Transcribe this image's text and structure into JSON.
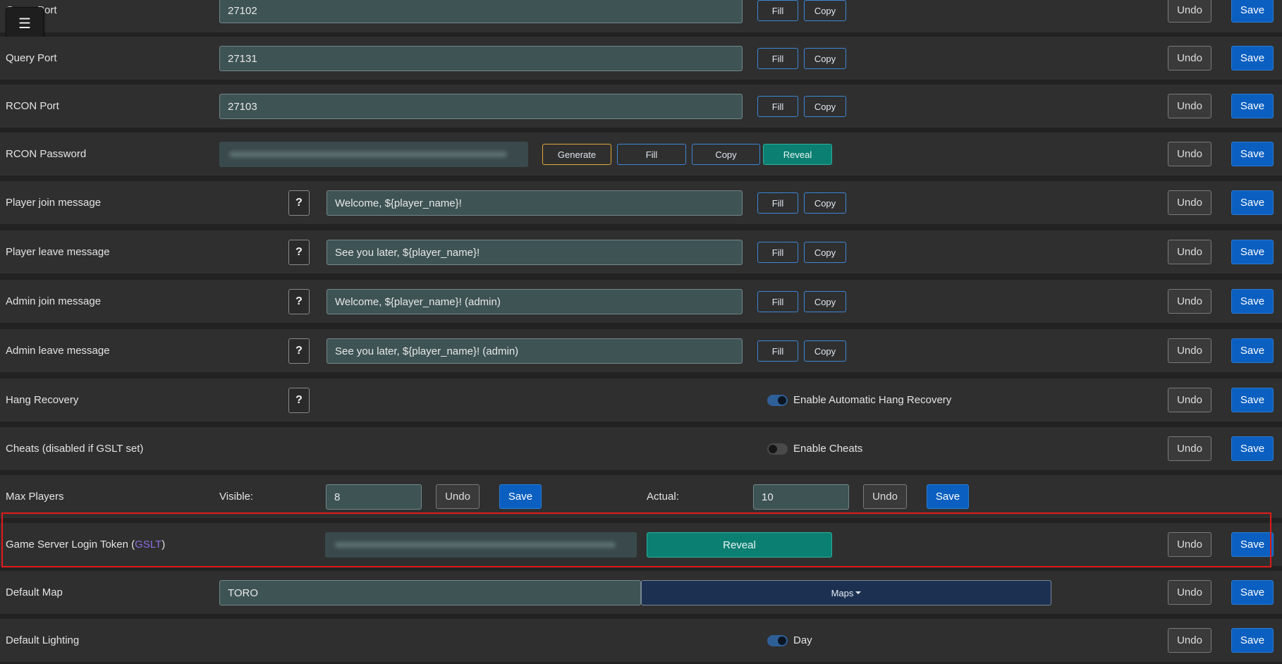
{
  "menu": {
    "icon": "☰"
  },
  "common": {
    "fill": "Fill",
    "copy": "Copy",
    "undo": "Undo",
    "save": "Save",
    "generate": "Generate",
    "reveal": "Reveal",
    "help": "?"
  },
  "rows": {
    "game_port": {
      "label": "Game Port",
      "value": "27102"
    },
    "query_port": {
      "label": "Query Port",
      "value": "27131"
    },
    "rcon_port": {
      "label": "RCON Port",
      "value": "27103"
    },
    "rcon_password": {
      "label": "RCON Password"
    },
    "player_join": {
      "label": "Player join message",
      "value": "Welcome, ${player_name}!"
    },
    "player_leave": {
      "label": "Player leave message",
      "value": "See you later, ${player_name}!"
    },
    "admin_join": {
      "label": "Admin join message",
      "value": "Welcome, ${player_name}! (admin)"
    },
    "admin_leave": {
      "label": "Admin leave message",
      "value": "See you later, ${player_name}! (admin)"
    },
    "hang_recovery": {
      "label": "Hang Recovery",
      "toggle_label": "Enable Automatic Hang Recovery",
      "enabled": true
    },
    "cheats": {
      "label": "Cheats (disabled if GSLT set)",
      "toggle_label": "Enable Cheats",
      "enabled": false
    },
    "max_players": {
      "label": "Max Players",
      "visible_label": "Visible:",
      "visible_value": "8",
      "actual_label": "Actual:",
      "actual_value": "10"
    },
    "gslt": {
      "label_prefix": "Game Server Login Token (",
      "link": "GSLT",
      "label_suffix": ")"
    },
    "default_map": {
      "label": "Default Map",
      "value": "TORO",
      "maps_button": "Maps"
    },
    "default_lighting": {
      "label": "Default Lighting",
      "toggle_label": "Day",
      "enabled": true
    }
  },
  "colors": {
    "save": "#0b5fc0",
    "teal": "#0b7f72",
    "highlight": "#e01b1b",
    "link": "#8d6ee0"
  }
}
